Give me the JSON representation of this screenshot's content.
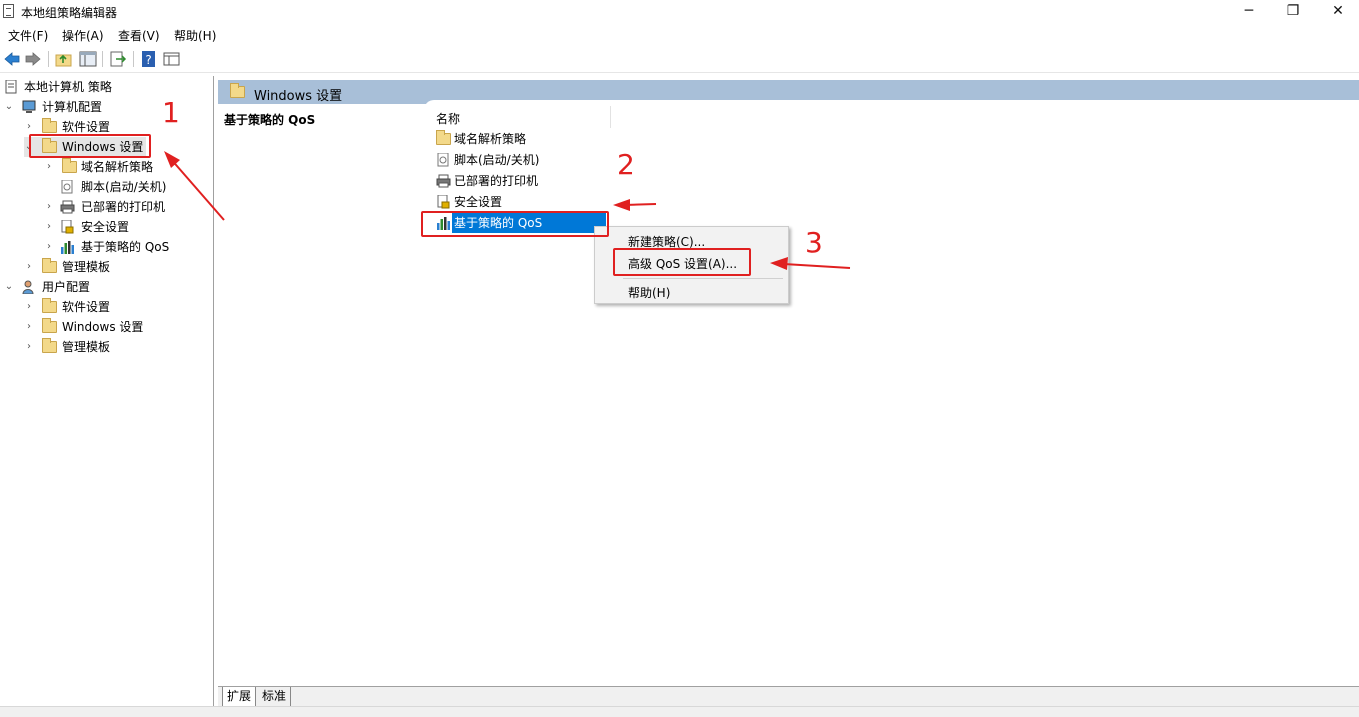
{
  "window": {
    "title": "本地组策略编辑器",
    "minimize": "─",
    "restore": "❐",
    "close": "✕"
  },
  "menu": [
    "文件(F)",
    "操作(A)",
    "查看(V)",
    "帮助(H)"
  ],
  "toolbar": [
    "back-icon",
    "forward-icon",
    "up-folder-icon",
    "show-hide-tree-icon",
    "export-icon",
    "help-icon",
    "properties-icon"
  ],
  "tree": {
    "root": "本地计算机 策略",
    "computer_config": "计算机配置",
    "cc_software": "软件设置",
    "cc_windows": "Windows 设置",
    "cc_windows_children": [
      "域名解析策略",
      "脚本(启动/关机)",
      "已部署的打印机",
      "安全设置",
      "基于策略的 QoS"
    ],
    "cc_admin": "管理模板",
    "user_config": "用户配置",
    "uc_software": "软件设置",
    "uc_windows": "Windows 设置",
    "uc_admin": "管理模板"
  },
  "right": {
    "header": "Windows 设置",
    "desc_title": "基于策略的 QoS",
    "column_name": "名称",
    "items": [
      "域名解析策略",
      "脚本(启动/关机)",
      "已部署的打印机",
      "安全设置",
      "基于策略的 QoS"
    ]
  },
  "context_menu": {
    "new_policy": "新建策略(C)...",
    "advanced_qos": "高级 QoS 设置(A)...",
    "help": "帮助(H)"
  },
  "tabs": [
    "扩展",
    "标准"
  ],
  "annotations": [
    "1",
    "2",
    "3"
  ],
  "colors": {
    "annotation": "#e02020",
    "selection": "#0078d7",
    "header": "#a8bfd8"
  }
}
